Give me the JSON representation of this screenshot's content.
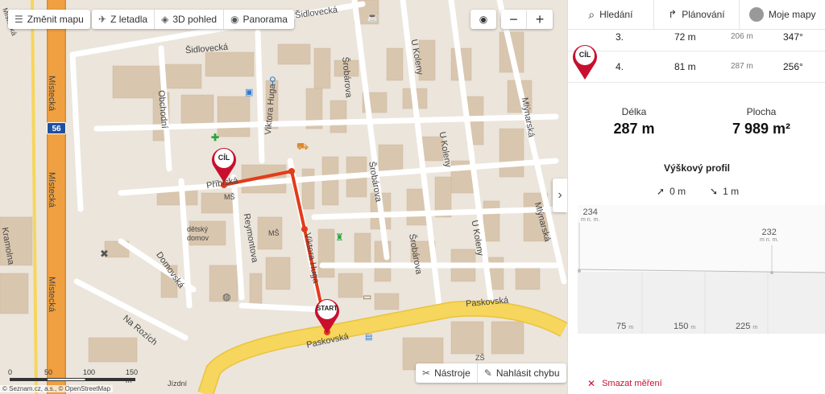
{
  "toolbar": {
    "change_map": "Změnit mapu",
    "aerial": "Z letadla",
    "view3d": "3D pohled",
    "panorama": "Panorama"
  },
  "zoom": {
    "locate_icon": "locate-icon",
    "minus": "−",
    "plus": "+"
  },
  "map": {
    "streets": {
      "sidlovecka_top": "Šidlovecká",
      "sidlovecka": "Šidlovecká",
      "obchodni": "Obchodní",
      "viktora_huga_top": "Viktora Huga",
      "viktora_huga": "Viktora Huga",
      "pribicka": "Příbiská",
      "reymontova": "Reymontova",
      "domovska": "Domovská",
      "na_rozich": "Na Rozích",
      "paskovska_road": "Paskovská",
      "paskovska": "Paskovská",
      "srobarova_top": "Šrobárova",
      "srobarova_mid": "Šrobárova",
      "srobarova_bot": "Šrobárova",
      "u_koleny_top": "U Koleny",
      "u_koleny_mid": "U Koleny",
      "u_koleny_bot": "U Koleny",
      "mlynarska_top": "Mlýnarská",
      "mlynarska_bot": "Mlýnarská",
      "mistecka_top": "Místecká",
      "mistecka_mid": "Místecká",
      "mistecka_bot": "Místecká",
      "kramolna": "Kramolna",
      "mistecka_corner": "Místecká",
      "jizdni": "Jízdní"
    },
    "road_badge": "56",
    "places": {
      "ms1": "MŠ",
      "ms2": "MŠ",
      "home": "dětský\ndomov",
      "zs": "ZŠ"
    },
    "pins": {
      "end": "CÍL",
      "start": "START"
    },
    "scale": {
      "t0": "0",
      "t1": "50",
      "t2": "100",
      "t3": "150 m"
    },
    "copyright": "© Seznam.cz, a.s., © OpenStreetMap",
    "tools": "Nástroje",
    "report": "Nahlásit chybu"
  },
  "nav": {
    "search": "Hledání",
    "planning": "Plánování",
    "my_maps": "Moje mapy"
  },
  "rows": [
    {
      "idx": "3.",
      "dist": "72 m",
      "cum": "206 m",
      "angle": "347°"
    },
    {
      "idx": "4.",
      "dist": "81 m",
      "cum": "287 m",
      "angle": "256°"
    }
  ],
  "panel_pin": "CÍL",
  "stats": {
    "length_label": "Délka",
    "length": "287 m",
    "area_label": "Plocha",
    "area": "7 989 m²"
  },
  "profile": {
    "title": "Výškový profil",
    "up": "0 m",
    "down": "1 m",
    "elev_start": "234",
    "elev_end": "232",
    "unit": "m n. m.",
    "x_ticks": [
      {
        "v": "75",
        "u": "m"
      },
      {
        "v": "150",
        "u": "m"
      },
      {
        "v": "225",
        "u": "m"
      }
    ]
  },
  "delete_label": "Smazat měření",
  "colors": {
    "route": "#e33b1b",
    "pin": "#c8102e",
    "road_yellow": "#f6d65c",
    "road_orange": "#f0a040"
  }
}
